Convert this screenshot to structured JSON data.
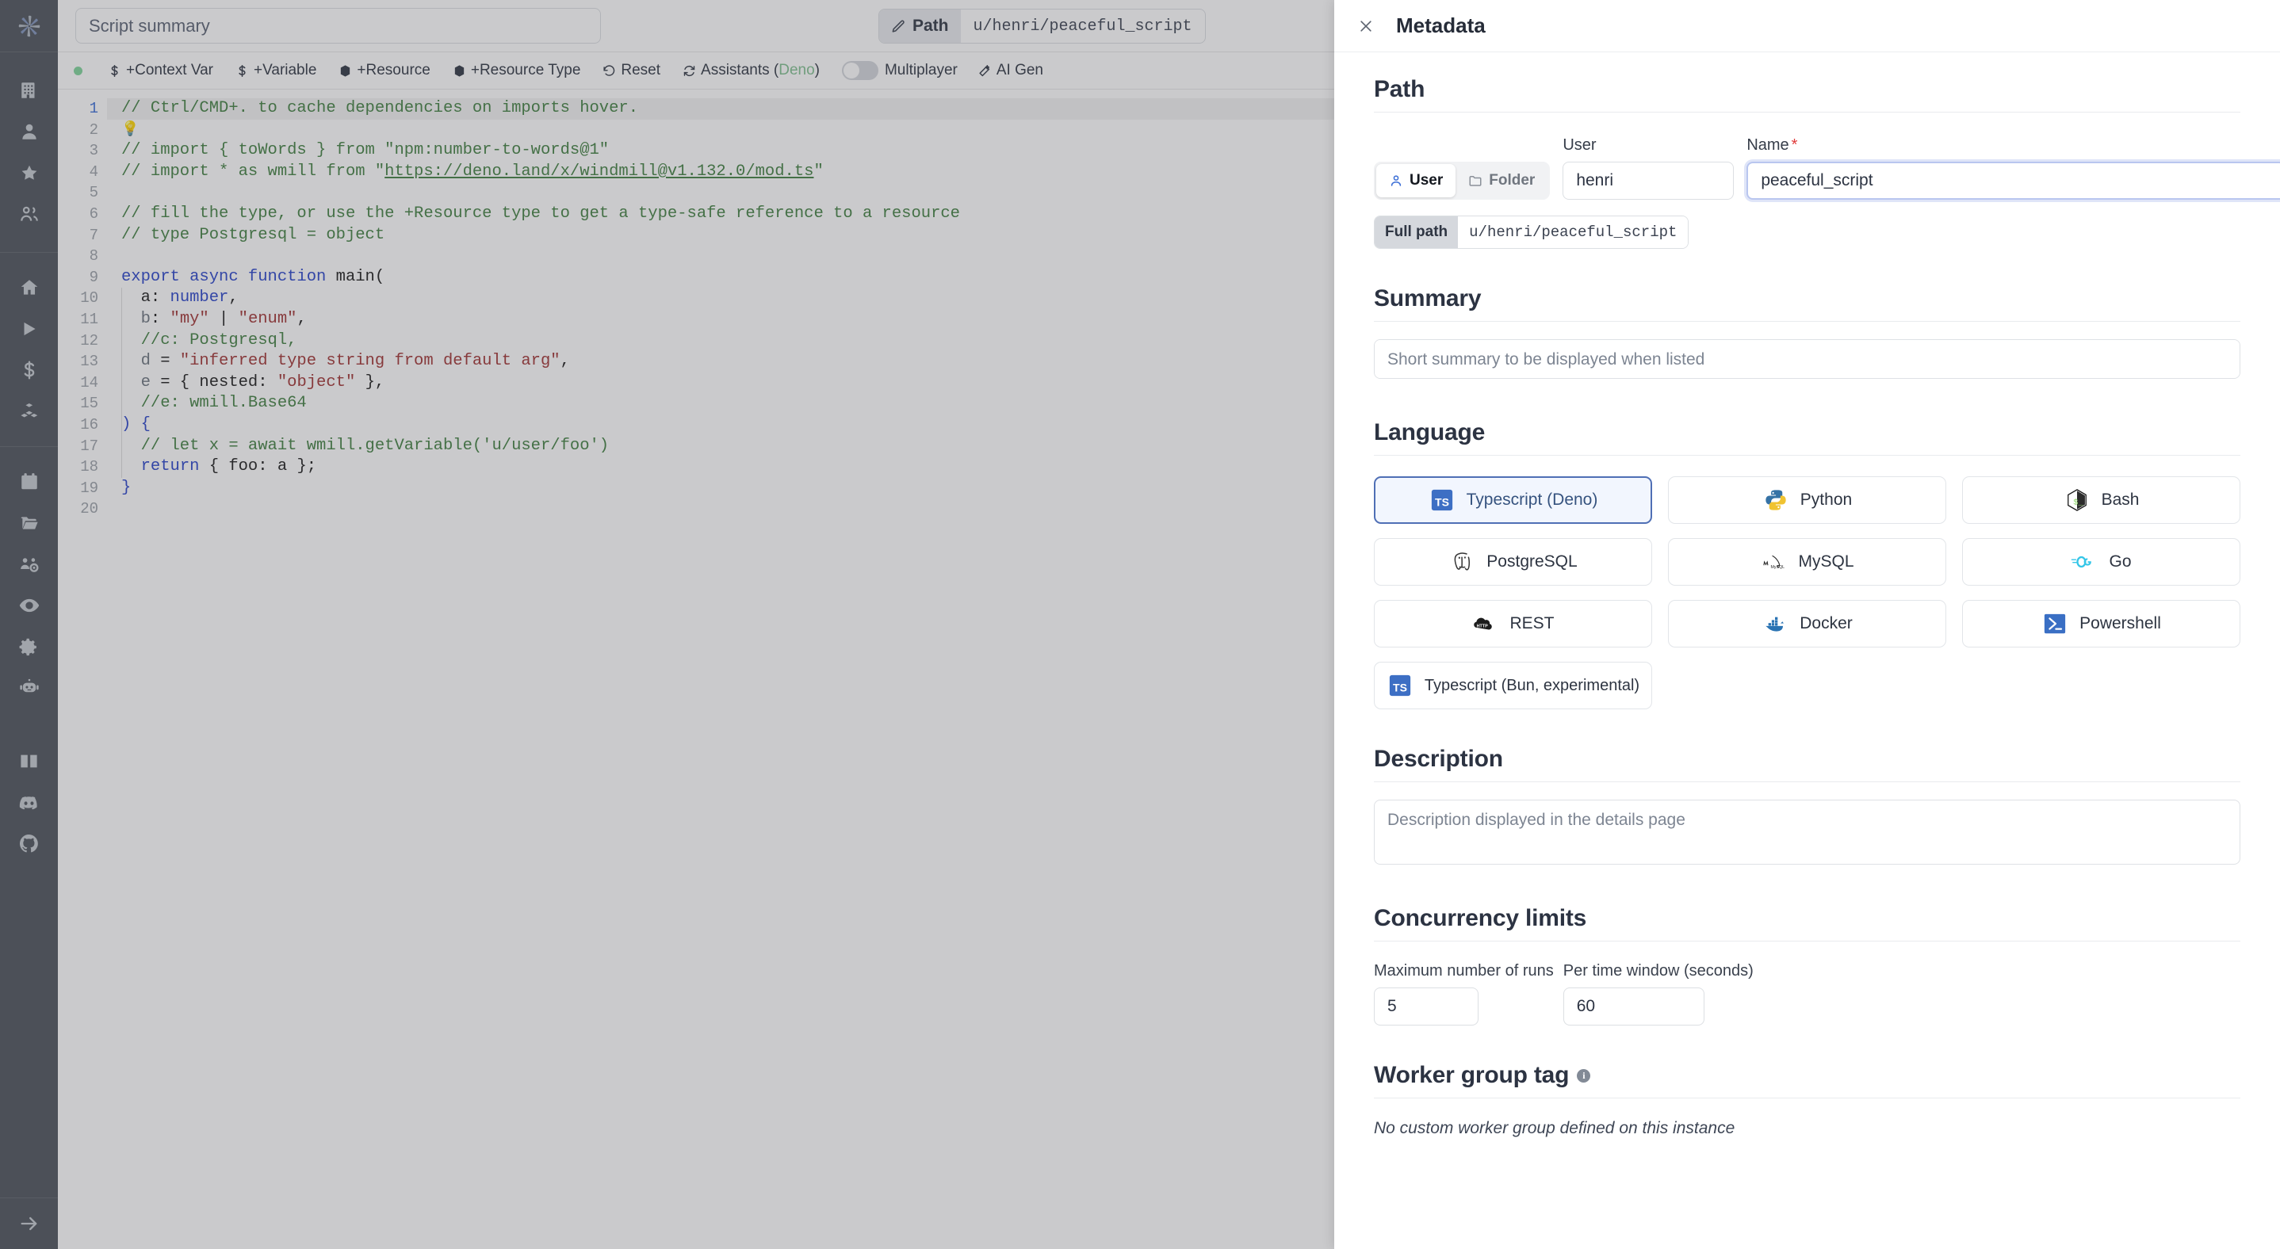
{
  "sidebar": {
    "logo": "windmill-logo-icon",
    "items": [
      {
        "name": "building-icon",
        "label": "Workspace"
      },
      {
        "name": "user-icon",
        "label": "User"
      },
      {
        "name": "star-icon",
        "label": "Favorites"
      },
      {
        "name": "users-icon",
        "label": "Groups"
      },
      {
        "name": "home-icon",
        "label": "Home"
      },
      {
        "name": "play-icon",
        "label": "Runs"
      },
      {
        "name": "dollar-icon",
        "label": "Variables"
      },
      {
        "name": "cubes-icon",
        "label": "Resources"
      },
      {
        "name": "calendar-icon",
        "label": "Schedules"
      },
      {
        "name": "folder-icon",
        "label": "Folders"
      },
      {
        "name": "group-settings-icon",
        "label": "Groups"
      },
      {
        "name": "eye-icon",
        "label": "Audit logs"
      },
      {
        "name": "gear-icon",
        "label": "Settings"
      },
      {
        "name": "robot-icon",
        "label": "Workers"
      },
      {
        "name": "book-icon",
        "label": "Docs"
      },
      {
        "name": "discord-icon",
        "label": "Discord"
      },
      {
        "name": "github-icon",
        "label": "GitHub"
      },
      {
        "name": "arrow-right-icon",
        "label": "Expand"
      }
    ]
  },
  "topbar": {
    "summary_placeholder": "Script summary",
    "summary_value": "",
    "path_button_label": "Path",
    "path_value": "u/henri/peaceful_script"
  },
  "toolbar": {
    "status_dot_color": "#7fd59a",
    "buttons": [
      {
        "icon": "dollar-icon",
        "label": "+Context Var"
      },
      {
        "icon": "dollar-icon",
        "label": "+Variable"
      },
      {
        "icon": "box-icon",
        "label": "+Resource"
      },
      {
        "icon": "box-icon",
        "label": "+Resource Type"
      },
      {
        "icon": "reset-icon",
        "label": "Reset"
      },
      {
        "icon": "refresh-icon",
        "label": "Assistants (",
        "suffix_lang": "Deno",
        "suffix_close": ")"
      }
    ],
    "multiplayer_label": "Multiplayer",
    "multiplayer_on": false,
    "ai_gen_label": "AI Gen",
    "ai_gen_icon": "wand-icon"
  },
  "editor": {
    "language": "typescript",
    "active_line": 1,
    "lines": [
      {
        "n": 1,
        "tokens": [
          {
            "t": "// Ctrl/CMD+. to cache dependencies on imports hover.",
            "c": "c-com"
          }
        ]
      },
      {
        "n": 2,
        "tokens": [
          {
            "t": " ",
            "c": "c-plain"
          }
        ],
        "bulb": true
      },
      {
        "n": 3,
        "tokens": [
          {
            "t": "// import { toWords } from \"npm:number-to-words@1\"",
            "c": "c-com"
          }
        ]
      },
      {
        "n": 4,
        "tokens": [
          {
            "t": "// import * as wmill from \"",
            "c": "c-com"
          },
          {
            "t": "https://deno.land/x/windmill@v1.132.0/mod.ts",
            "c": "c-link"
          },
          {
            "t": "\"",
            "c": "c-com"
          }
        ]
      },
      {
        "n": 5,
        "tokens": [
          {
            "t": "",
            "c": "c-plain"
          }
        ]
      },
      {
        "n": 6,
        "tokens": [
          {
            "t": "// fill the type, or use the +Resource type to get a type-safe reference to a resource",
            "c": "c-com"
          }
        ]
      },
      {
        "n": 7,
        "tokens": [
          {
            "t": "// type Postgresql = object",
            "c": "c-com"
          }
        ]
      },
      {
        "n": 8,
        "tokens": [
          {
            "t": "",
            "c": "c-plain"
          }
        ]
      },
      {
        "n": 9,
        "tokens": [
          {
            "t": "export async function ",
            "c": "c-kw"
          },
          {
            "t": "main",
            "c": "c-fn"
          },
          {
            "t": "(",
            "c": "c-plain"
          }
        ]
      },
      {
        "n": 10,
        "tokens": [
          {
            "t": "  a",
            "c": "c-plain"
          },
          {
            "t": ": ",
            "c": "c-plain"
          },
          {
            "t": "number",
            "c": "c-kw"
          },
          {
            "t": ",",
            "c": "c-plain"
          }
        ]
      },
      {
        "n": 11,
        "tokens": [
          {
            "t": "  b",
            "c": "c-var"
          },
          {
            "t": ": ",
            "c": "c-plain"
          },
          {
            "t": "\"my\"",
            "c": "c-str"
          },
          {
            "t": " | ",
            "c": "c-plain"
          },
          {
            "t": "\"enum\"",
            "c": "c-str"
          },
          {
            "t": ",",
            "c": "c-plain"
          }
        ]
      },
      {
        "n": 12,
        "tokens": [
          {
            "t": "  //c: Postgresql,",
            "c": "c-com"
          }
        ]
      },
      {
        "n": 13,
        "tokens": [
          {
            "t": "  d",
            "c": "c-var"
          },
          {
            "t": " = ",
            "c": "c-plain"
          },
          {
            "t": "\"inferred type string from default arg\"",
            "c": "c-str"
          },
          {
            "t": ",",
            "c": "c-plain"
          }
        ]
      },
      {
        "n": 14,
        "tokens": [
          {
            "t": "  e",
            "c": "c-var"
          },
          {
            "t": " = { ",
            "c": "c-plain"
          },
          {
            "t": "nested",
            "c": "c-plain"
          },
          {
            "t": ": ",
            "c": "c-plain"
          },
          {
            "t": "\"object\"",
            "c": "c-str"
          },
          {
            "t": " },",
            "c": "c-plain"
          }
        ]
      },
      {
        "n": 15,
        "tokens": [
          {
            "t": "  //e: wmill.Base64",
            "c": "c-com"
          }
        ]
      },
      {
        "n": 16,
        "tokens": [
          {
            "t": ") {",
            "c": "c-kw"
          }
        ]
      },
      {
        "n": 17,
        "tokens": [
          {
            "t": "  // let x = await wmill.getVariable('u/user/foo')",
            "c": "c-com"
          }
        ]
      },
      {
        "n": 18,
        "tokens": [
          {
            "t": "  ",
            "c": "c-plain"
          },
          {
            "t": "return",
            "c": "c-kw"
          },
          {
            "t": " { foo: a };",
            "c": "c-plain"
          }
        ]
      },
      {
        "n": 19,
        "tokens": [
          {
            "t": "}",
            "c": "c-kw"
          }
        ]
      },
      {
        "n": 20,
        "tokens": [
          {
            "t": "",
            "c": "c-plain"
          }
        ]
      }
    ]
  },
  "drawer": {
    "title": "Metadata",
    "close_icon": "close-icon",
    "path": {
      "section_title": "Path",
      "owner_kinds": [
        {
          "name": "user-kind",
          "label": "User",
          "icon": "user-icon",
          "active": true
        },
        {
          "name": "folder-kind",
          "label": "Folder",
          "icon": "folder-icon",
          "active": false
        }
      ],
      "user_label": "User",
      "user_value": "henri",
      "name_label": "Name",
      "name_required": "*",
      "name_value": "peaceful_script",
      "full_path_label": "Full path",
      "full_path_value": "u/henri/peaceful_script"
    },
    "summary": {
      "section_title": "Summary",
      "placeholder": "Short summary to be displayed when listed",
      "value": ""
    },
    "language": {
      "section_title": "Language",
      "options": [
        {
          "label": "Typescript (Deno)",
          "icon": "typescript-icon",
          "selected": true
        },
        {
          "label": "Python",
          "icon": "python-icon",
          "selected": false
        },
        {
          "label": "Bash",
          "icon": "bash-icon",
          "selected": false
        },
        {
          "label": "PostgreSQL",
          "icon": "postgresql-icon",
          "selected": false
        },
        {
          "label": "MySQL",
          "icon": "mysql-icon",
          "selected": false
        },
        {
          "label": "Go",
          "icon": "go-icon",
          "selected": false
        },
        {
          "label": "REST",
          "icon": "rest-icon",
          "selected": false
        },
        {
          "label": "Docker",
          "icon": "docker-icon",
          "selected": false
        },
        {
          "label": "Powershell",
          "icon": "powershell-icon",
          "selected": false
        },
        {
          "label": "Typescript (Bun, experimental)",
          "icon": "typescript-icon",
          "selected": false
        }
      ]
    },
    "description": {
      "section_title": "Description",
      "placeholder": "Description displayed in the details page",
      "value": ""
    },
    "concurrency": {
      "section_title": "Concurrency limits",
      "max_runs_label": "Maximum number of runs",
      "max_runs_value": "5",
      "time_window_label": "Per time window (seconds)",
      "time_window_value": "60"
    },
    "worker_group": {
      "section_title": "Worker group tag",
      "info_icon": "info-icon",
      "empty_text": "No custom worker group defined on this instance"
    }
  },
  "colors": {
    "sidebar_bg": "#4b5159",
    "accent_blue": "#3b6ed6",
    "selected_lang_border": "#4f6fb5",
    "selected_lang_bg": "#f2f6fe",
    "required_red": "#e03b3b",
    "status_green": "#7fd59a"
  }
}
